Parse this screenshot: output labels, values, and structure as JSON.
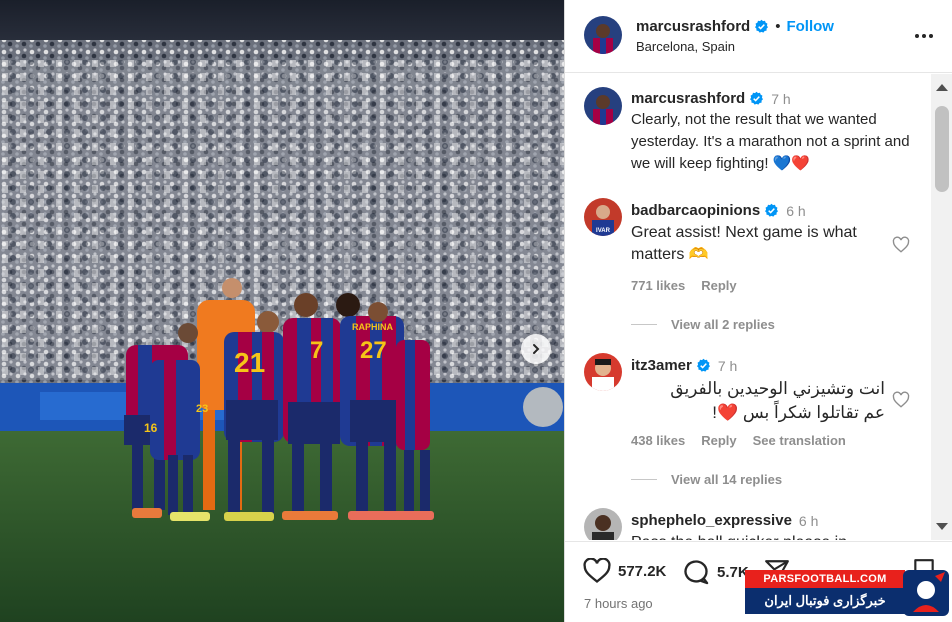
{
  "post": {
    "username": "marcusrashford",
    "follow_label": "Follow",
    "location": "Barcelona, Spain",
    "caption_username": "marcusrashford",
    "caption_time": "7 h",
    "caption": "Clearly, not the result that we wanted yesterday. It's a marathon not a sprint and we will keep fighting! 💙❤️",
    "likes": "577.2K",
    "comments_count": "5.7K",
    "posted_ago": "7 hours ago"
  },
  "photo": {
    "jersey_numbers": [
      "21",
      "7",
      "27",
      "16",
      "23"
    ],
    "jersey_name": "RAPHINA"
  },
  "comments": [
    {
      "username": "badbarcaopinions",
      "time": "6 h",
      "text": "Great assist! Next game is what matters 🫶",
      "likes": "771 likes",
      "reply_label": "Reply",
      "view_replies": "View all 2 replies",
      "avatar_text": "IVAR"
    },
    {
      "username": "itz3amer",
      "time": "7 h",
      "text_line1": "انت وتشيزني الوحيدين بالفريق",
      "text_line2": "عم تقاتلوا شكراً بس ❤️!",
      "likes": "438 likes",
      "reply_label": "Reply",
      "translation_label": "See translation",
      "view_replies": "View all 14 replies"
    },
    {
      "username": "sphephelo_expressive",
      "time": "6 h",
      "text": "Pass the ball quicker please in"
    }
  ],
  "watermark": {
    "site": "PARSFOOTBALL.COM",
    "tagline": "خبرگزاری فوتبال ایران"
  },
  "icons": {
    "verified": "verified-badge-icon",
    "heart": "heart-icon",
    "comment": "comment-icon",
    "share": "share-icon",
    "bookmark": "bookmark-icon",
    "more": "more-options-icon",
    "next": "chevron-right-icon"
  },
  "colors": {
    "accent": "#0095f6",
    "barca_blue": "#1f3a93",
    "barca_garnet": "#a50044",
    "pitch": "#2f5a2c"
  }
}
